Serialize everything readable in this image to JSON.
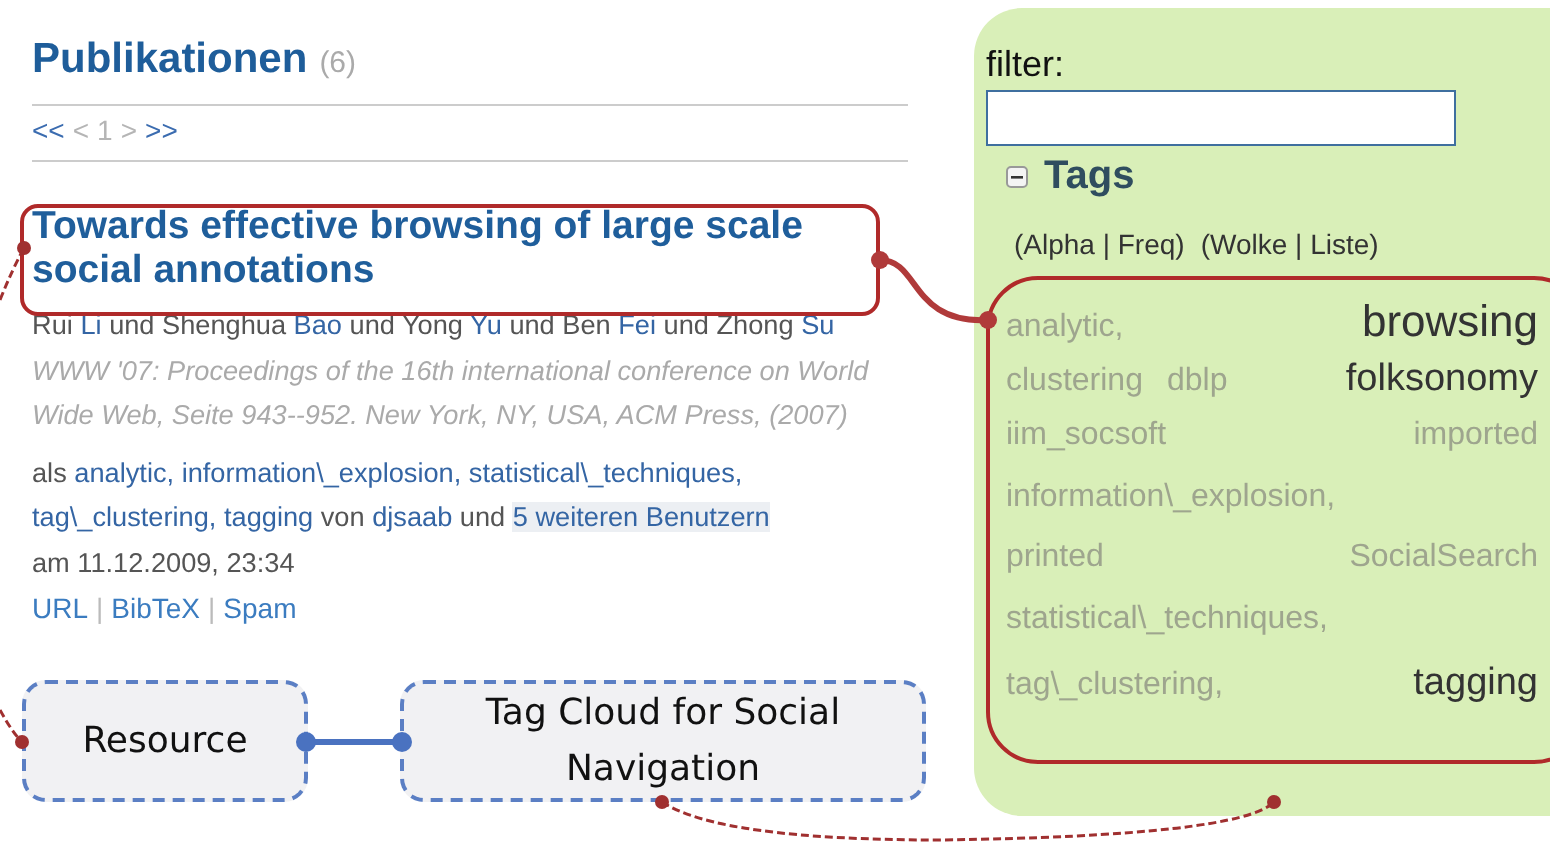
{
  "publications": {
    "heading": "Publikationen",
    "count": "(6)",
    "pager": [
      {
        "text": "<<",
        "disabled": false
      },
      {
        "text": "<",
        "disabled": true
      },
      {
        "text": "1",
        "disabled": true
      },
      {
        "text": ">",
        "disabled": true
      },
      {
        "text": ">>",
        "disabled": false
      }
    ],
    "entry": {
      "title": "Towards effective browsing of large scale social annotations",
      "citation": [
        {
          "text": "Rui",
          "kind": "plain"
        },
        {
          "text": "Li",
          "kind": "link"
        },
        {
          "text": "und Shenghua",
          "kind": "plain"
        },
        {
          "text": "Bao",
          "kind": "link"
        },
        {
          "text": "und Yong",
          "kind": "plain"
        },
        {
          "text": "Yu",
          "kind": "link"
        },
        {
          "text": "und Ben",
          "kind": "plain"
        },
        {
          "text": "Fei",
          "kind": "link"
        },
        {
          "text": "und Zhong",
          "kind": "plain"
        },
        {
          "text": "Su",
          "kind": "link"
        },
        {
          "text": "WWW '07: Proceedings of the 16th international conference on World Wide Web, Seite 943--952. New York, NY, USA, ACM Press, (2007)",
          "kind": "venue"
        }
      ],
      "tagline": [
        {
          "text": "als",
          "kind": "plain"
        },
        {
          "text": "analytic,",
          "kind": "link"
        },
        {
          "text": "information\\_explosion,",
          "kind": "link"
        },
        {
          "text": "statistical\\_techniques,",
          "kind": "link"
        },
        {
          "text": "tag\\_clustering,",
          "kind": "link"
        },
        {
          "text": "tagging",
          "kind": "link"
        },
        {
          "text": "von",
          "kind": "plain"
        },
        {
          "text": "djsaab",
          "kind": "link"
        },
        {
          "text": "und",
          "kind": "plain"
        },
        {
          "text": "5 weiteren Benutzern",
          "kind": "highlight"
        }
      ],
      "date": "am 11.12.2009, 23:34",
      "actions": [
        "URL",
        "BibTeX",
        "Spam"
      ],
      "separator": "|"
    }
  },
  "sidebar": {
    "filter_label": "filter:",
    "tags_heading": "Tags",
    "expanded": true,
    "options": [
      "(Alpha | Freq)",
      "(Wolke | Liste)"
    ],
    "cloud": [
      {
        "text": "analytic,",
        "kind": "minor"
      },
      {
        "text": "browsing",
        "kind": "top"
      },
      {
        "text": "clustering",
        "kind": "minor"
      },
      {
        "text": "dblp",
        "kind": "minor"
      },
      {
        "text": "folksonomy",
        "kind": "major"
      },
      {
        "text": "iim_socsoft",
        "kind": "minor"
      },
      {
        "text": "imported",
        "kind": "minor"
      },
      {
        "text": "information\\_explosion,",
        "kind": "minor"
      },
      {
        "text": "printed",
        "kind": "minor"
      },
      {
        "text": "SocialSearch",
        "kind": "minor"
      },
      {
        "text": "statistical\\_techniques,",
        "kind": "minor"
      },
      {
        "text": "tag\\_clustering,",
        "kind": "minor"
      },
      {
        "text": "tagging",
        "kind": "major"
      }
    ]
  },
  "annotations": [
    {
      "label": "Resource"
    },
    {
      "label": "Tag Cloud for Social Navigation"
    }
  ]
}
